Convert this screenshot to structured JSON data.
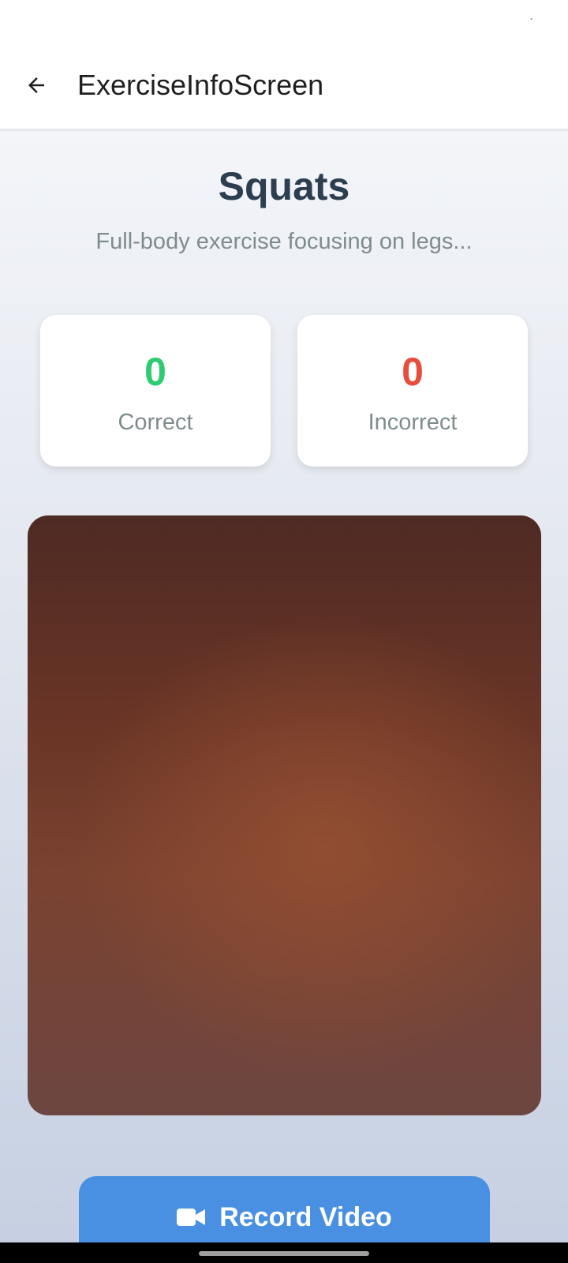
{
  "status_bar": {
    "mark": "´"
  },
  "app_bar": {
    "back_icon": "arrow-left-icon",
    "title": "ExerciseInfoScreen"
  },
  "exercise": {
    "title": "Squats",
    "description": "Full-body exercise focusing on legs..."
  },
  "stats": {
    "correct": {
      "value": "0",
      "label": "Correct",
      "color": "#2ecc71"
    },
    "incorrect": {
      "value": "0",
      "label": "Incorrect",
      "color": "#e74c3c"
    }
  },
  "camera": {
    "state": "live-preview"
  },
  "record_button": {
    "icon": "video-camera-icon",
    "label": "Record Video",
    "color": "#4a90e2"
  },
  "colors": {
    "title": "#2c3e50",
    "muted": "#7f8c8d"
  }
}
